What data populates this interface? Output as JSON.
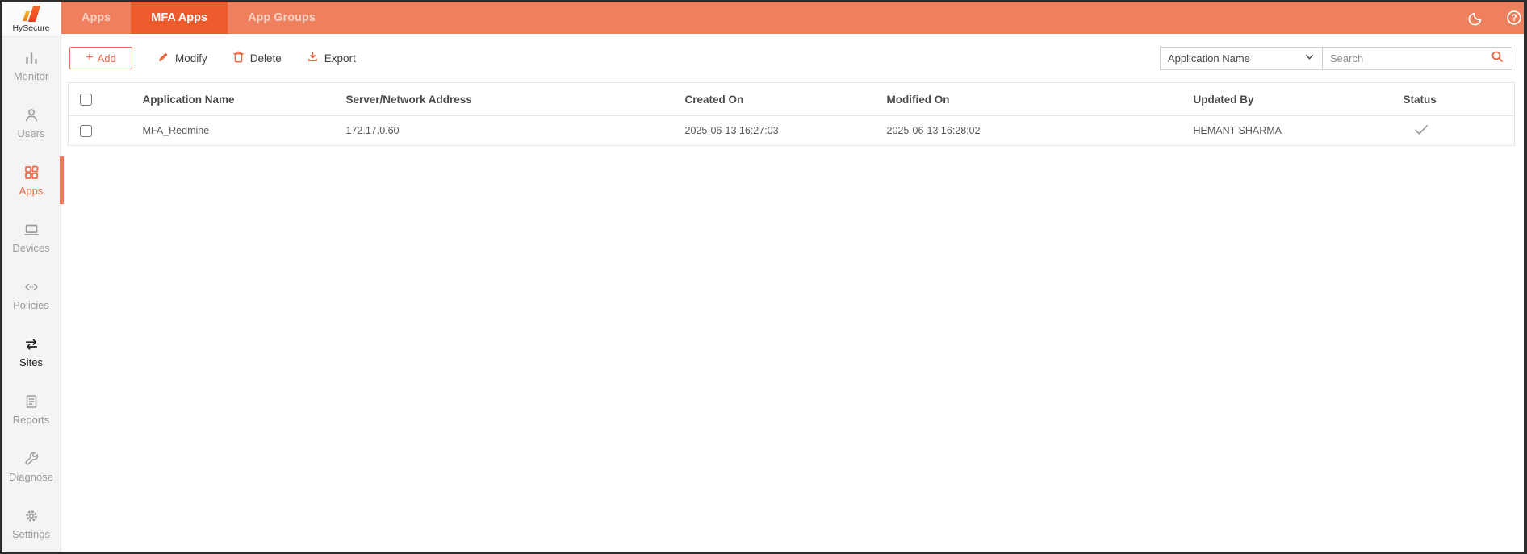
{
  "brand": {
    "name": "HySecure"
  },
  "topbar": {
    "tabs": [
      {
        "label": "Apps",
        "active": false
      },
      {
        "label": "MFA Apps",
        "active": true
      },
      {
        "label": "App Groups",
        "active": false
      }
    ],
    "icons": [
      "moon-icon",
      "help-icon"
    ]
  },
  "sidebar": {
    "items": [
      {
        "label": "Monitor",
        "icon": "bar-chart-icon",
        "state": "default"
      },
      {
        "label": "Users",
        "icon": "user-icon",
        "state": "default"
      },
      {
        "label": "Apps",
        "icon": "app-grid-icon",
        "state": "active"
      },
      {
        "label": "Devices",
        "icon": "laptop-icon",
        "state": "default"
      },
      {
        "label": "Policies",
        "icon": "code-brackets-icon",
        "state": "default"
      },
      {
        "label": "Sites",
        "icon": "swap-arrows-icon",
        "state": "dark"
      },
      {
        "label": "Reports",
        "icon": "document-icon",
        "state": "default"
      },
      {
        "label": "Diagnose",
        "icon": "wrench-icon",
        "state": "default"
      },
      {
        "label": "Settings",
        "icon": "gear-icon",
        "state": "default"
      }
    ]
  },
  "toolbar": {
    "add_label": "Add",
    "modify_label": "Modify",
    "delete_label": "Delete",
    "export_label": "Export",
    "filter_selected": "Application Name",
    "search_placeholder": "Search"
  },
  "table": {
    "columns": [
      "Application Name",
      "Server/Network Address",
      "Created On",
      "Modified On",
      "Updated By",
      "Status"
    ],
    "rows": [
      {
        "application_name": "MFA_Redmine",
        "server_address": "172.17.0.60",
        "created_on": "2025-06-13 16:27:03",
        "modified_on": "2025-06-13 16:28:02",
        "updated_by": "HEMANT SHARMA",
        "status": "checked"
      }
    ]
  },
  "colors": {
    "topbar_bg": "#EF805D",
    "active_tab_bg": "#EE5B2D",
    "accent_orange": "#ED6A45",
    "sidebar_bg": "#F4F4F5",
    "status_check": "#9AA0A6"
  }
}
